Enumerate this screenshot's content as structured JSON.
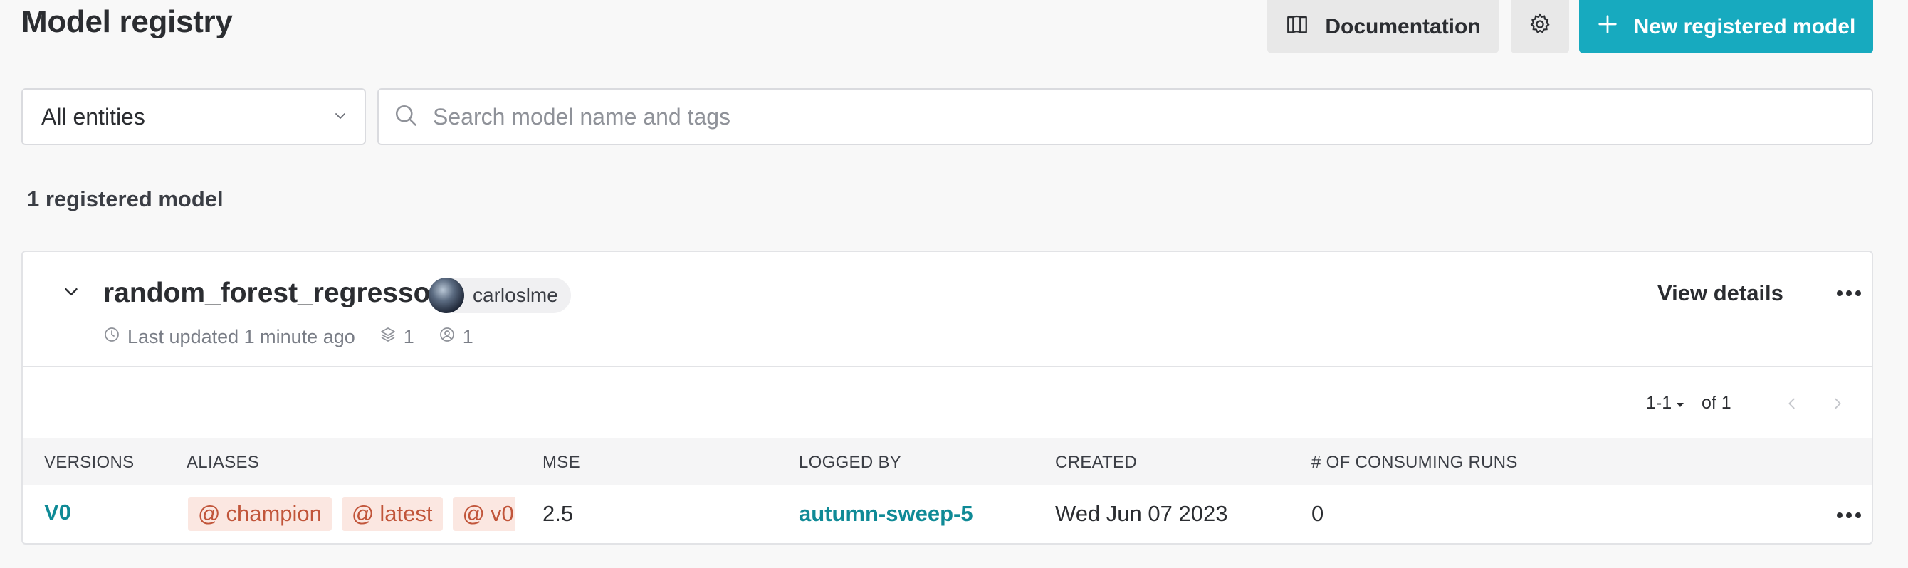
{
  "header": {
    "title": "Model registry",
    "doc_label": "Documentation",
    "new_label": "New registered model"
  },
  "filters": {
    "entity_value": "All entities",
    "search_placeholder": "Search model name and tags"
  },
  "summary": {
    "count_label": "1 registered model"
  },
  "model": {
    "name": "random_forest_regressor",
    "owner": "carloslme",
    "view_details_label": "View details",
    "last_updated": "Last updated 1 minute ago",
    "versions_count": "1",
    "users_count": "1"
  },
  "pagination": {
    "range": "1-1",
    "of": "of 1"
  },
  "table": {
    "columns": [
      "VERSIONS",
      "ALIASES",
      "MSE",
      "LOGGED BY",
      "CREATED",
      "# OF CONSUMING RUNS"
    ],
    "rows": [
      {
        "version": "V0",
        "aliases": [
          "champion",
          "latest",
          "v0"
        ],
        "mse": "2.5",
        "logged_by": "autumn-sweep-5",
        "created": "Wed Jun 07 2023",
        "consuming_runs": "0"
      }
    ]
  },
  "colors": {
    "accent": "#17aabf",
    "link": "#0f8a96",
    "alias_bg": "#fbe7e1",
    "alias_text": "#c1553a"
  }
}
